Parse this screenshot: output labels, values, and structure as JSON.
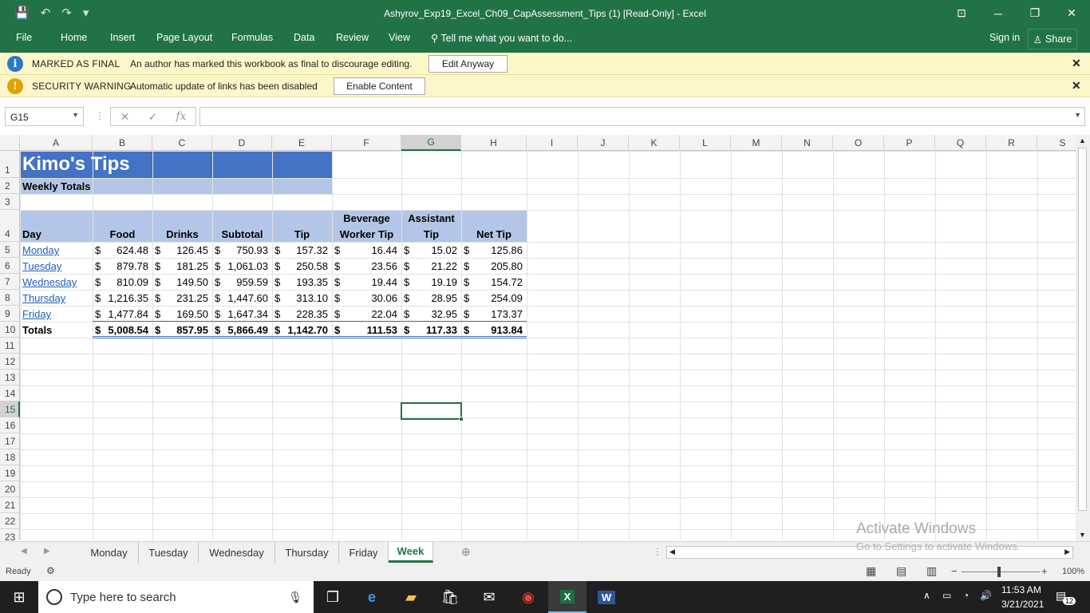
{
  "window": {
    "title": "Ashyrov_Exp19_Excel_Ch09_CapAssessment_Tips (1)  [Read-Only] - Excel",
    "controls": [
      "⊡",
      "─",
      "❐",
      "✕"
    ]
  },
  "ribbon": {
    "tabs": [
      "File",
      "Home",
      "Insert",
      "Page Layout",
      "Formulas",
      "Data",
      "Review",
      "View"
    ],
    "tell_me": "Tell me what you want to do...",
    "sign_in": "Sign in",
    "share": "Share"
  },
  "messages": {
    "final": {
      "label": "MARKED AS FINAL",
      "text": "An author has marked this workbook as final to discourage editing.",
      "button": "Edit Anyway"
    },
    "security": {
      "label": "SECURITY WARNING",
      "text": "Automatic update of links has been disabled",
      "button": "Enable Content"
    }
  },
  "formula_bar": {
    "name_box": "G15",
    "formula": ""
  },
  "columns": [
    "A",
    "B",
    "C",
    "D",
    "E",
    "F",
    "G",
    "H",
    "I",
    "J",
    "K",
    "L",
    "M",
    "N",
    "O",
    "P",
    "Q",
    "R",
    "S"
  ],
  "rows": [
    "1",
    "2",
    "3",
    "4",
    "5",
    "6",
    "7",
    "8",
    "9",
    "10",
    "11",
    "12",
    "13",
    "14",
    "15",
    "16",
    "17",
    "18",
    "19",
    "20",
    "21",
    "22",
    "23"
  ],
  "sheet": {
    "title": "Kimo's Tips",
    "subtitle": "Weekly Totals",
    "headers": {
      "day": "Day",
      "food": "Food",
      "drinks": "Drinks",
      "subtotal": "Subtotal",
      "tip": "Tip",
      "bev_line1": "Beverage",
      "bev_line2": "Worker Tip",
      "asst_line1": "Assistant",
      "asst_line2": "Tip",
      "net": "Net Tip"
    },
    "currency": "$",
    "data_rows": [
      {
        "day": "Monday",
        "food": "624.48",
        "drinks": "126.45",
        "subtotal": "750.93",
        "tip": "157.32",
        "bev": "16.44",
        "asst": "15.02",
        "net": "125.86"
      },
      {
        "day": "Tuesday",
        "food": "879.78",
        "drinks": "181.25",
        "subtotal": "1,061.03",
        "tip": "250.58",
        "bev": "23.56",
        "asst": "21.22",
        "net": "205.80"
      },
      {
        "day": "Wednesday",
        "food": "810.09",
        "drinks": "149.50",
        "subtotal": "959.59",
        "tip": "193.35",
        "bev": "19.44",
        "asst": "19.19",
        "net": "154.72"
      },
      {
        "day": "Thursday",
        "food": "1,216.35",
        "drinks": "231.25",
        "subtotal": "1,447.60",
        "tip": "313.10",
        "bev": "30.06",
        "asst": "28.95",
        "net": "254.09"
      },
      {
        "day": "Friday",
        "food": "1,477.84",
        "drinks": "169.50",
        "subtotal": "1,647.34",
        "tip": "228.35",
        "bev": "22.04",
        "asst": "32.95",
        "net": "173.37"
      }
    ],
    "totals": {
      "day": "Totals",
      "food": "5,008.54",
      "drinks": "857.95",
      "subtotal": "5,866.49",
      "tip": "1,142.70",
      "bev": "111.53",
      "asst": "117.33",
      "net": "913.84"
    }
  },
  "sheet_tabs": [
    "Monday",
    "Tuesday",
    "Wednesday",
    "Thursday",
    "Friday",
    "Week"
  ],
  "active_sheet": "Week",
  "status": {
    "ready": "Ready",
    "zoom": "100%"
  },
  "watermark": {
    "line1": "Activate Windows",
    "line2": "Go to Settings to activate Windows."
  },
  "taskbar": {
    "search_placeholder": "Type here to search",
    "time": "11:53 AM",
    "date": "3/21/2021",
    "notifications": "12"
  },
  "colors": {
    "excel_green": "#217346",
    "title_band": "#4472c4",
    "header_band": "#b4c6e7",
    "message_bar": "#fdf6c8"
  }
}
